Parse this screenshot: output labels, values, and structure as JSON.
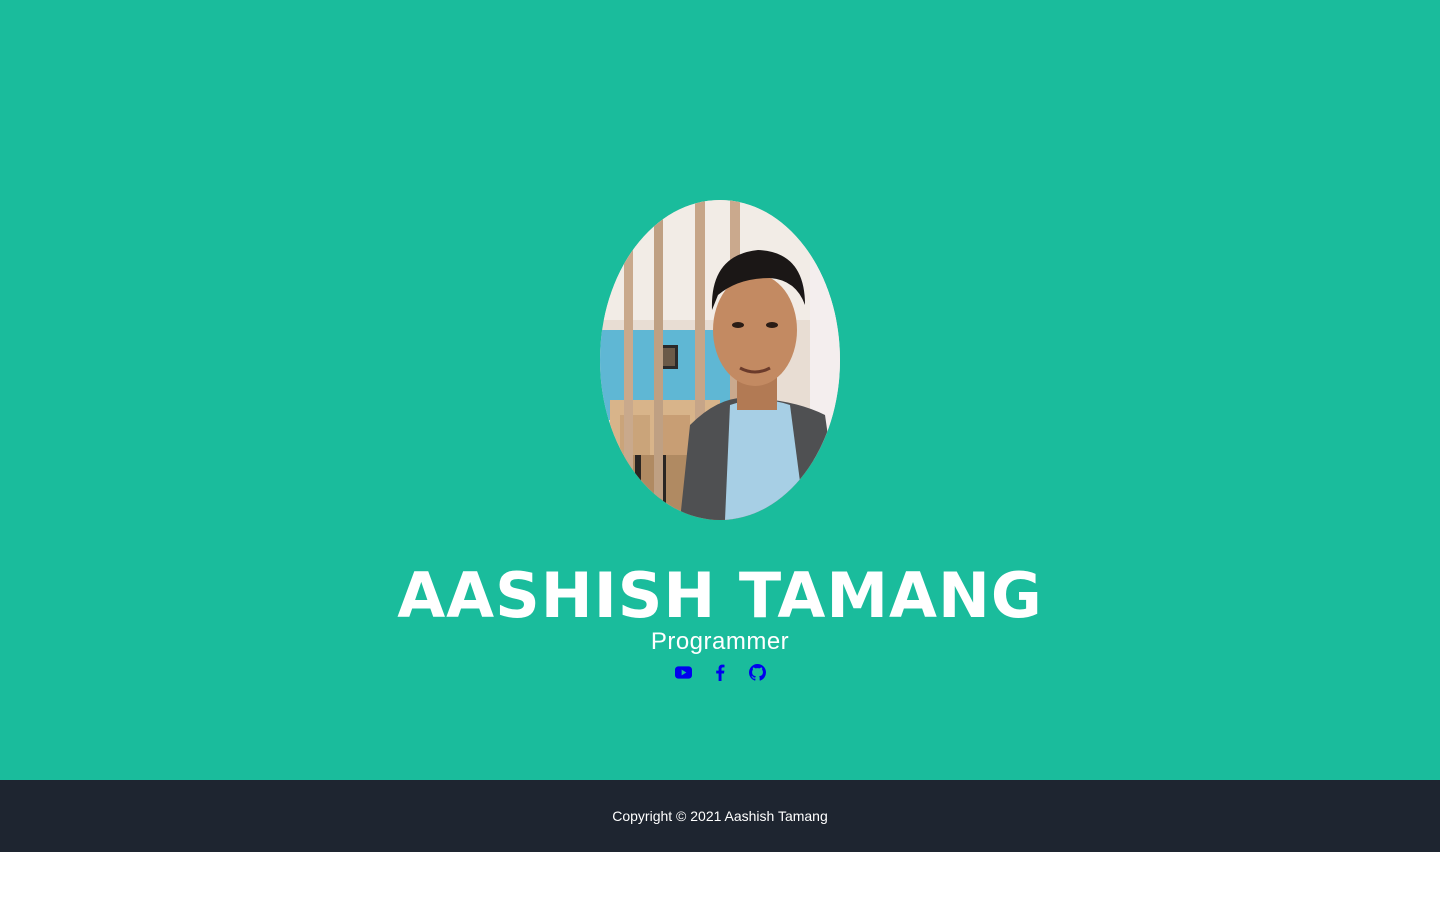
{
  "profile": {
    "name": "AASHISH TAMANG",
    "role": "Programmer",
    "photo_alt": "profile-photo"
  },
  "social": [
    {
      "icon": "youtube-icon",
      "label": "YouTube"
    },
    {
      "icon": "facebook-icon",
      "label": "Facebook"
    },
    {
      "icon": "github-icon",
      "label": "GitHub"
    }
  ],
  "footer": {
    "copyright": "Copyright © 2021 Aashish Tamang"
  },
  "colors": {
    "hero_bg": "#1abc9c",
    "footer_bg": "#1e2530",
    "icon_color": "#0000ee",
    "text": "#ffffff"
  }
}
